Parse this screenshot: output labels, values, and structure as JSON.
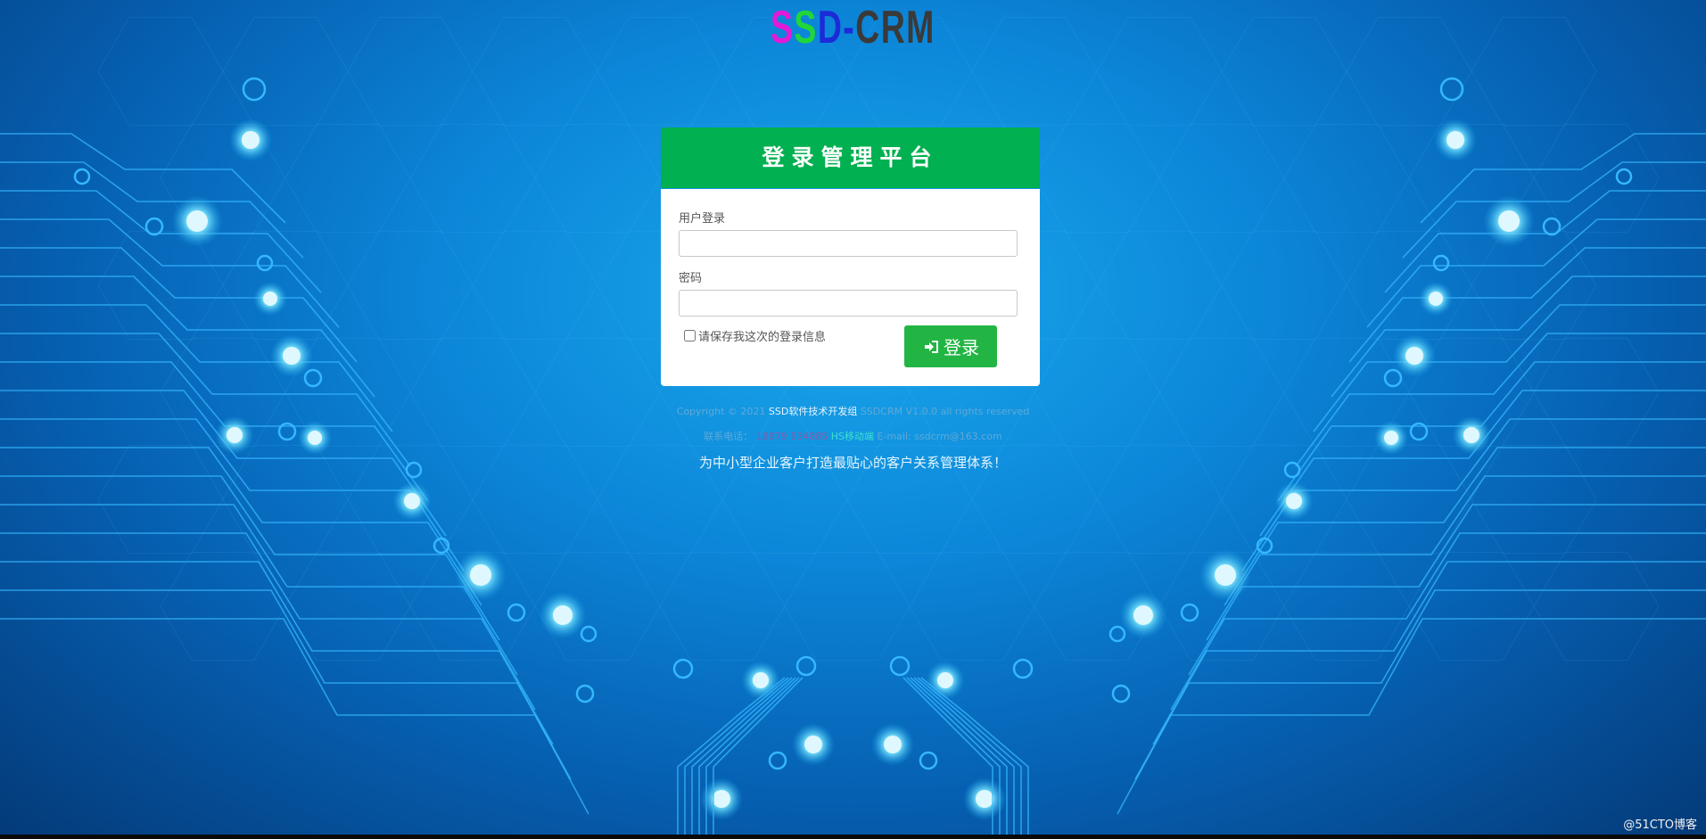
{
  "logo": {
    "letters": [
      "S",
      "S",
      "D-",
      "CRM"
    ],
    "colors": [
      "#e21ad8",
      "#21d63a",
      "#1c2bd8",
      "#3a3a3a"
    ]
  },
  "panel": {
    "title": "登录管理平台",
    "username_label": "用户登录",
    "password_label": "密码",
    "remember_label": "请保存我这次的登录信息",
    "login_label": "登录"
  },
  "footer": {
    "copyright_prefix": "Copyright © 2021",
    "org": "SSD软件技术开发组",
    "version_suffix": "SSDCRM V1.0.0 all rights reserved",
    "contact_label": "联系电话：",
    "phone": "18879 534885",
    "tag": "HS移动端",
    "email": "E-mail: ssdcrm@163.com"
  },
  "slogan": "为中小型企业客户打造最贴心的客户关系管理体系！",
  "watermark": "@51CTO博客",
  "colors": {
    "accent_green": "#01b050",
    "button_green": "#22b543"
  }
}
